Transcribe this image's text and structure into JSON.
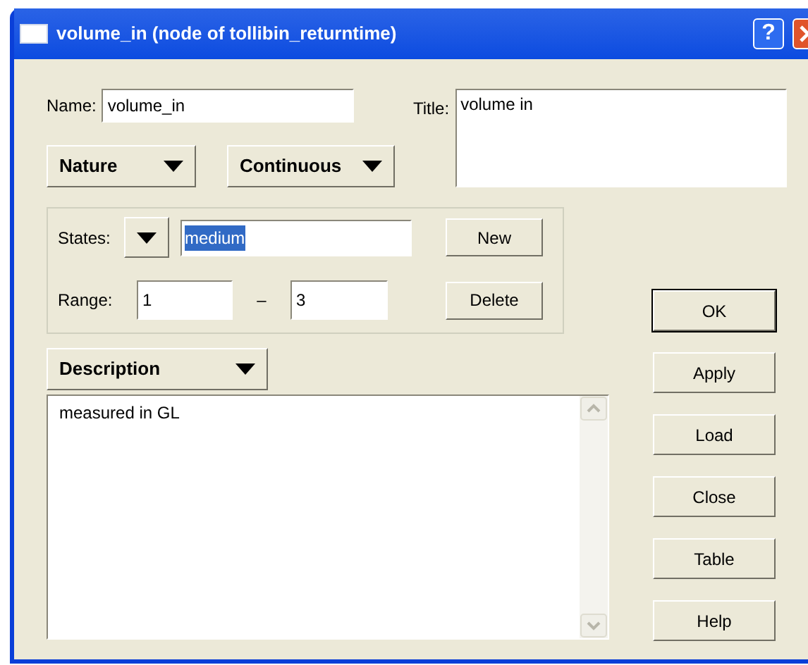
{
  "window": {
    "title": "volume_in (node of tollibin_returntime)",
    "help": "?"
  },
  "name": {
    "label": "Name:",
    "value": "volume_in"
  },
  "title": {
    "label": "Title:",
    "value": "volume in"
  },
  "dropdowns": [
    {
      "label": "Nature"
    },
    {
      "label": "Continuous"
    }
  ],
  "states": {
    "label": "States:",
    "value": "medium",
    "selected": true
  },
  "range": {
    "label": "Range:",
    "from": "1",
    "separator": "–",
    "to": "3"
  },
  "group_buttons": [
    {
      "label": "New"
    },
    {
      "label": "Delete"
    }
  ],
  "description": {
    "dropdown": "Description",
    "text": "measured in GL"
  },
  "buttons": [
    {
      "label": "OK",
      "default": true
    },
    {
      "label": "Apply",
      "default": false
    },
    {
      "label": "Load",
      "default": false
    },
    {
      "label": "Close",
      "default": false
    },
    {
      "label": "Table",
      "default": false
    },
    {
      "label": "Help",
      "default": false
    }
  ]
}
